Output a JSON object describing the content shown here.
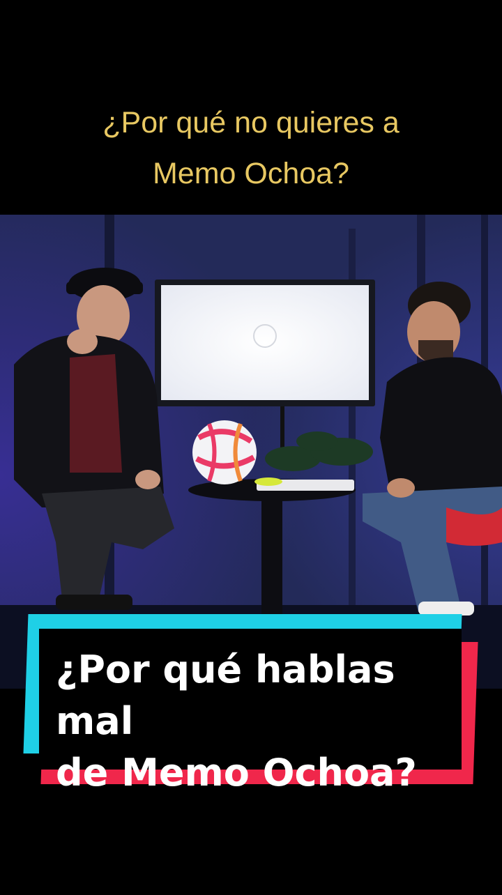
{
  "top_caption": {
    "line1": "¿Por qué no quieres a",
    "line2": "Memo Ochoa?"
  },
  "main_caption": {
    "line1": "¿Por qué hablas mal",
    "line2": "de Memo Ochoa?"
  },
  "colors": {
    "top_caption": "#e8c862",
    "card_cyan": "#1fd0e6",
    "card_red": "#f0274b",
    "card_bg": "#000000",
    "caption_text": "#ffffff"
  }
}
